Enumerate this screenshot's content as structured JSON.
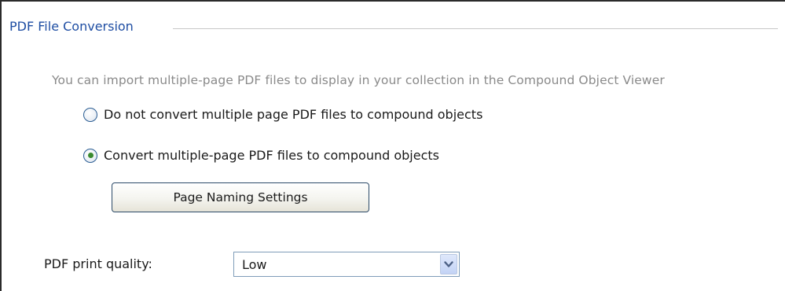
{
  "group": {
    "title": "PDF File Conversion"
  },
  "description": "You can import multiple-page PDF files to display in your collection in the Compound Object Viewer",
  "options": [
    {
      "label": "Do not convert multiple page PDF files to compound objects",
      "selected": false
    },
    {
      "label": "Convert multiple-page PDF files to compound objects",
      "selected": true
    }
  ],
  "naming_button": {
    "label": "Page Naming Settings"
  },
  "print_quality": {
    "label": "PDF print quality:",
    "value": "Low"
  },
  "icons": {
    "dropdown": "chevron-down-icon"
  },
  "colors": {
    "group_title": "#1f4ea3",
    "description": "#8a8a8a",
    "radio_selected": "#3a8a30"
  }
}
